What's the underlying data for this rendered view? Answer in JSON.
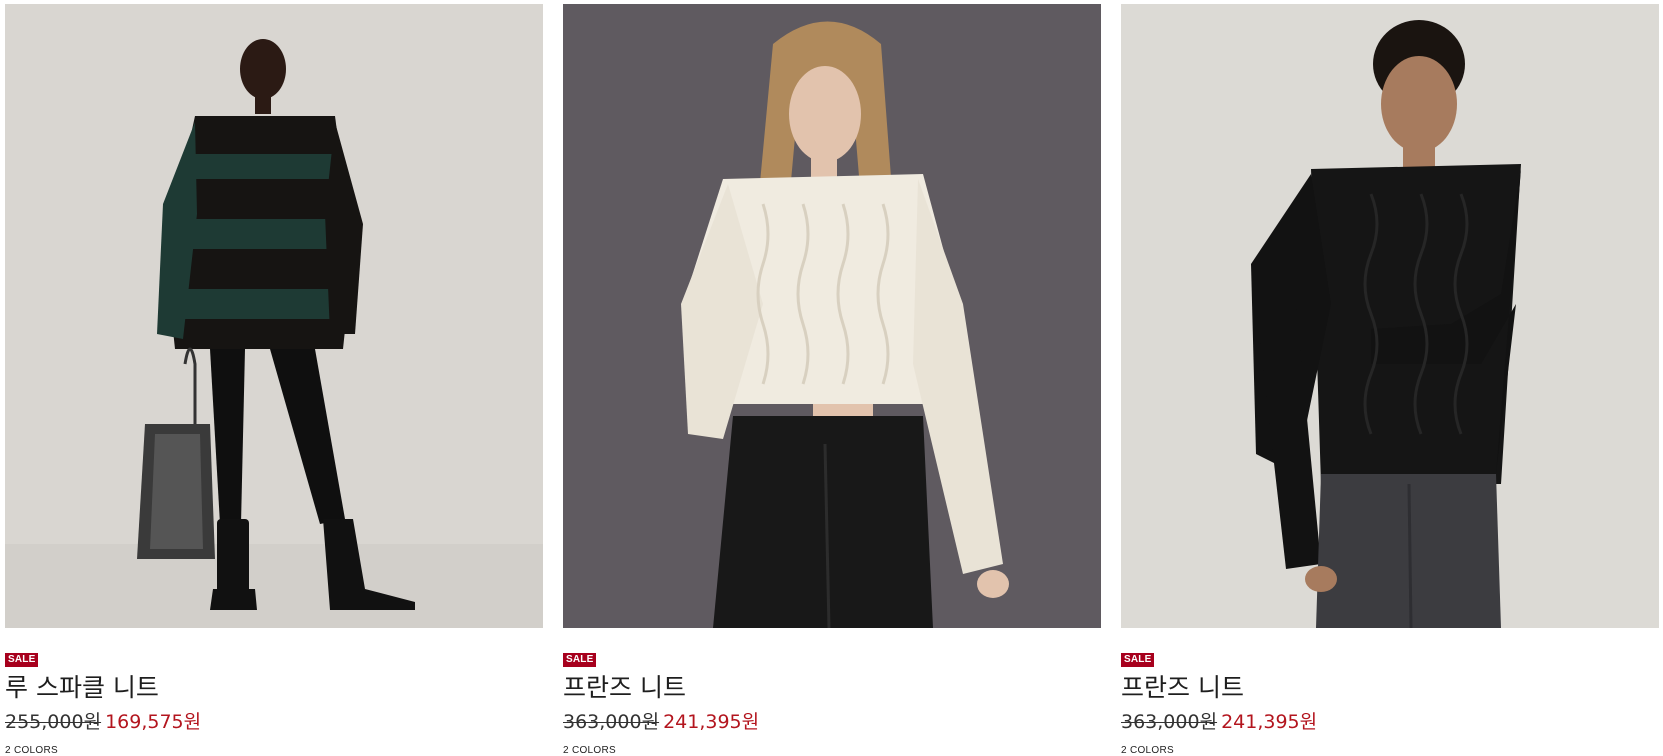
{
  "products": [
    {
      "badge": "SALE",
      "name": "루 스파클 니트",
      "original_price": "255,000원",
      "sale_price": "169,575원",
      "colors": "2 COLORS",
      "image": {
        "background": "#d9d6d1",
        "garment": "green-black striped oversized knit",
        "garment_color": "#1e3a34"
      }
    },
    {
      "badge": "SALE",
      "name": "프란즈 니트",
      "original_price": "363,000원",
      "sale_price": "241,395원",
      "colors": "2 COLORS",
      "image": {
        "background": "#5f5a60",
        "garment": "cream cable knit",
        "garment_color": "#f0ebe0"
      }
    },
    {
      "badge": "SALE",
      "name": "프란즈 니트",
      "original_price": "363,000원",
      "sale_price": "241,395원",
      "colors": "2 COLORS",
      "image": {
        "background": "#dcdad5",
        "garment": "black cable knit",
        "garment_color": "#151515"
      }
    }
  ],
  "colors": {
    "sale_badge": "#a7001d",
    "sale_price": "#b3151e",
    "text": "#222222"
  }
}
